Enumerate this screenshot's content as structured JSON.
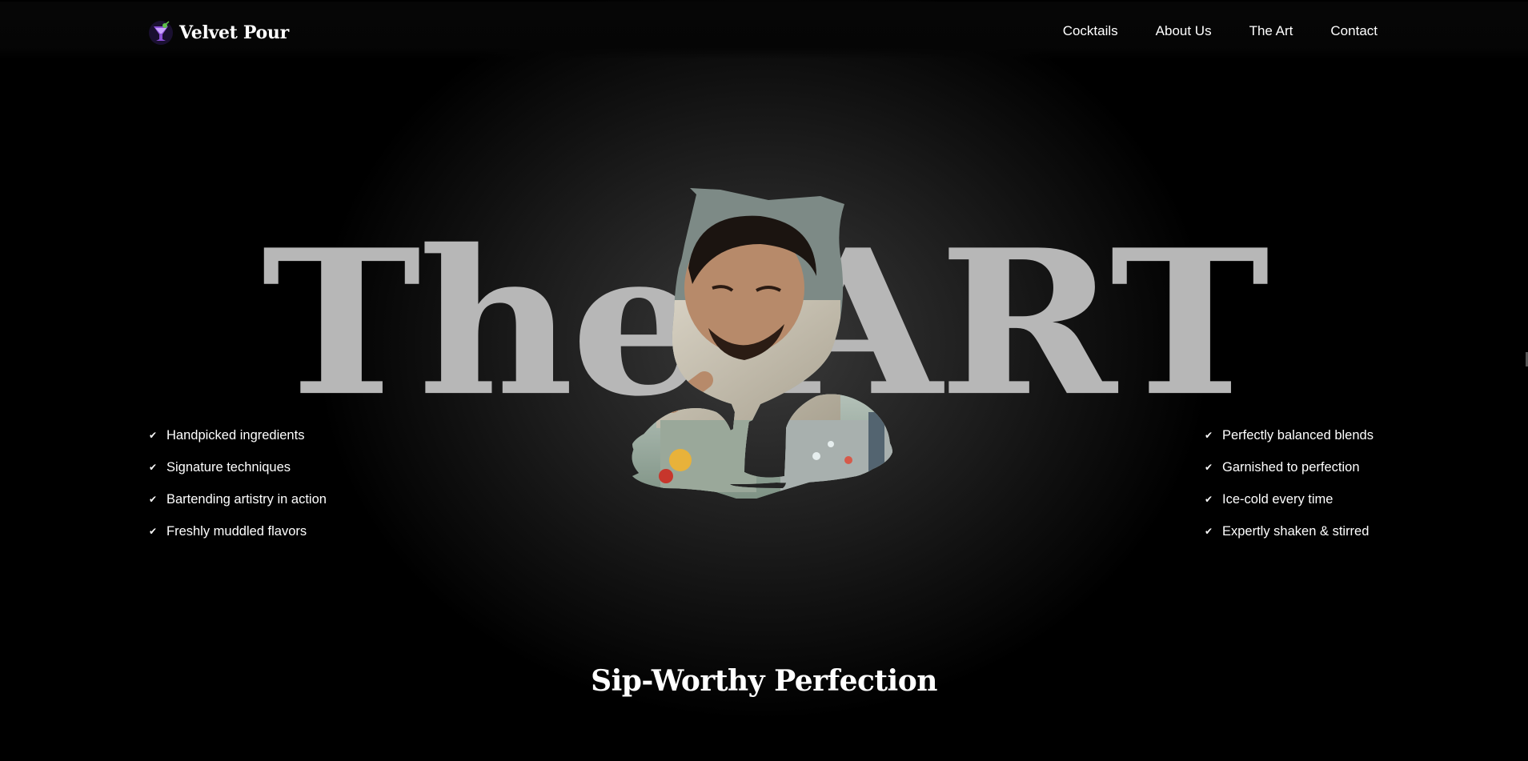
{
  "brand": {
    "name": "Velvet Pour",
    "logo_icon": "cocktail-glass-logo-icon",
    "accent": "#8a4fd6"
  },
  "nav": {
    "items": [
      {
        "label": "Cocktails"
      },
      {
        "label": "About Us"
      },
      {
        "label": "The Art"
      },
      {
        "label": "Contact"
      }
    ]
  },
  "hero": {
    "title": "The ART",
    "image_icon": "bartender-in-glass-silhouette-image",
    "tagline": "Sip-Worthy Perfection"
  },
  "features_left": [
    {
      "icon": "check-icon",
      "label": "Handpicked ingredients"
    },
    {
      "icon": "check-icon",
      "label": "Signature techniques"
    },
    {
      "icon": "check-icon",
      "label": "Bartending artistry in action"
    },
    {
      "icon": "check-icon",
      "label": "Freshly muddled flavors"
    }
  ],
  "features_right": [
    {
      "icon": "check-icon",
      "label": "Perfectly balanced blends"
    },
    {
      "icon": "check-icon",
      "label": "Garnished to perfection"
    },
    {
      "icon": "check-icon",
      "label": "Ice-cold every time"
    },
    {
      "icon": "check-icon",
      "label": "Expertly shaken & stirred"
    }
  ],
  "colors": {
    "background": "#000000",
    "title_gray": "#b7b7b7",
    "text": "#ffffff"
  }
}
